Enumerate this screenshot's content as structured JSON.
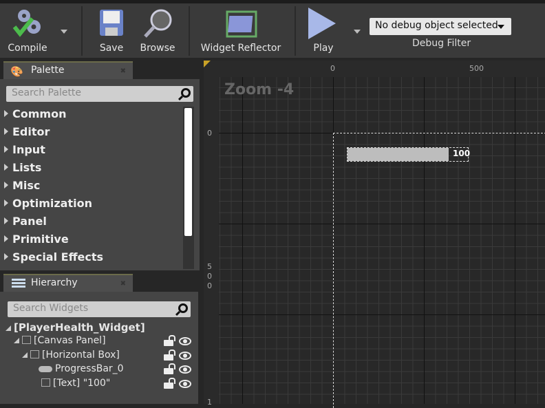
{
  "toolbar": {
    "compile": "Compile",
    "save": "Save",
    "browse": "Browse",
    "widget_reflector": "Widget Reflector",
    "play": "Play",
    "debug_object": "No debug object selected",
    "debug_filter": "Debug Filter"
  },
  "palette": {
    "title": "Palette",
    "search_placeholder": "Search Palette",
    "categories": [
      "Common",
      "Editor",
      "Input",
      "Lists",
      "Misc",
      "Optimization",
      "Panel",
      "Primitive",
      "Special Effects"
    ]
  },
  "hierarchy": {
    "title": "Hierarchy",
    "search_placeholder": "Search Widgets",
    "root": "[PlayerHealth_Widget]",
    "items": [
      "[Canvas Panel]",
      "[Horizontal Box]",
      "ProgressBar_0",
      "[Text] \"100\""
    ]
  },
  "designer": {
    "zoom": "Zoom -4",
    "ruler_top": [
      "0",
      "500"
    ],
    "ruler_left": [
      "0",
      "5",
      "0",
      "0",
      "1"
    ],
    "progress_percent": 100,
    "text_value": "100"
  }
}
